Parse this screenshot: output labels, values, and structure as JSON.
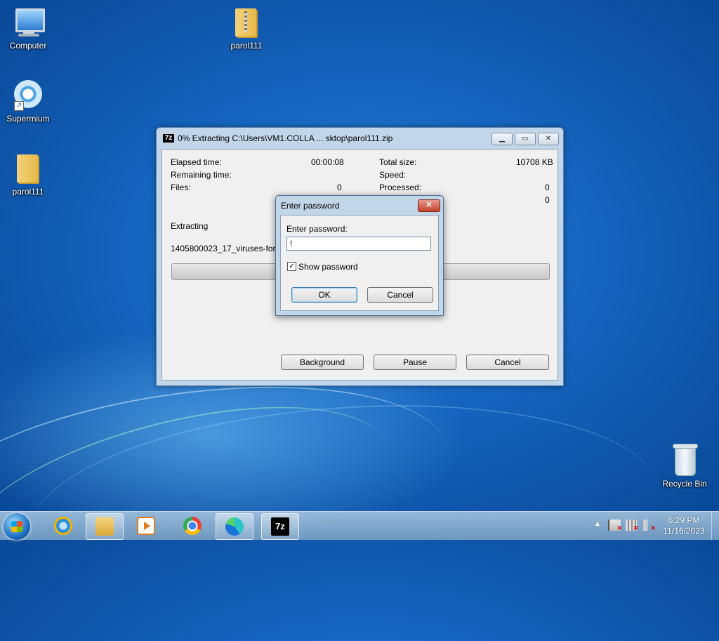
{
  "desktop": {
    "icons": [
      {
        "label": "Computer",
        "icon": "computer-icon"
      },
      {
        "label": "parol111",
        "icon": "zip-folder-icon"
      },
      {
        "label": "Supermium",
        "icon": "supermium-icon"
      },
      {
        "label": "parol111",
        "icon": "folder-icon"
      },
      {
        "label": "Recycle Bin",
        "icon": "recycle-bin-icon"
      }
    ]
  },
  "progress_window": {
    "title": "0% Extracting C:\\Users\\VM1.COLLA ... sktop\\parol111.zip",
    "app_icon_text": "7z",
    "stats": {
      "elapsed_label": "Elapsed time:",
      "elapsed_value": "00:00:08",
      "remaining_label": "Remaining time:",
      "files_label": "Files:",
      "files_value": "0",
      "total_size_label": "Total size:",
      "total_size_value": "10708 KB",
      "speed_label": "Speed:",
      "processed_label": "Processed:",
      "processed_value": "0",
      "extra_value": "0"
    },
    "status": "Extracting",
    "current_file": "1405800023_17_viruses-for-ant",
    "progress": 0,
    "buttons": {
      "background": "Background",
      "pause": "Pause",
      "cancel": "Cancel"
    }
  },
  "password_dialog": {
    "title": "Enter password",
    "close_symbol": "✕",
    "label": "Enter password:",
    "value": "!",
    "show_password_label": "Show password",
    "show_password_checked": true,
    "ok": "OK",
    "cancel": "Cancel"
  },
  "taskbar": {
    "items": [
      "internet-explorer-icon",
      "file-explorer-icon",
      "media-player-icon",
      "chrome-icon",
      "edge-icon",
      "7zip-icon"
    ],
    "sevenz_text": "7z",
    "tray_arrow": "▲",
    "time": "6:29 PM",
    "date": "11/16/2023"
  }
}
